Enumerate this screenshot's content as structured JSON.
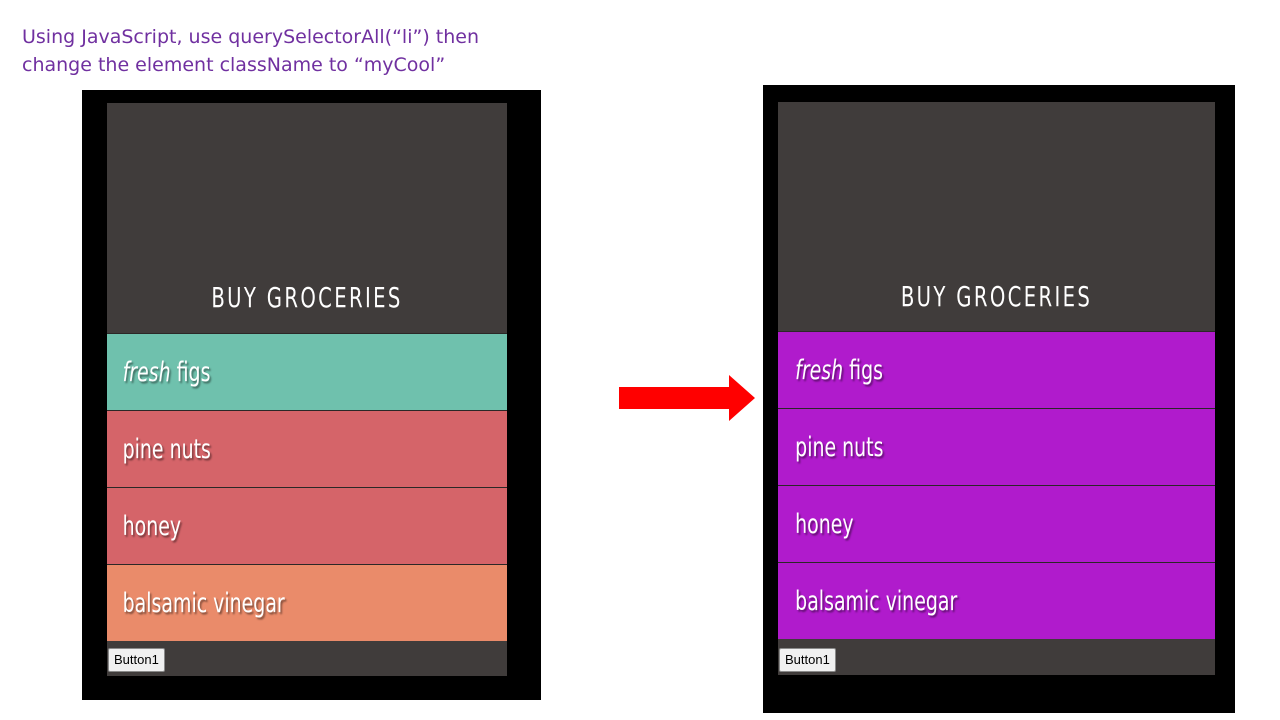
{
  "caption": {
    "line1": "Using JavaScript, use querySelectorAll(“li”) then",
    "line2": "change the element className to “myCool”"
  },
  "left_app": {
    "title": "BUY GROCERIES",
    "items": [
      {
        "emphasis": "fresh",
        "label": " figs",
        "color": "#6fc1ad"
      },
      {
        "emphasis": "",
        "label": "pine nuts",
        "color": "#d56469"
      },
      {
        "emphasis": "",
        "label": "honey",
        "color": "#d56469"
      },
      {
        "emphasis": "",
        "label": "balsamic vinegar",
        "color": "#ea8b6a"
      }
    ],
    "button_label": "Button1"
  },
  "right_app": {
    "title": "BUY GROCERIES",
    "items": [
      {
        "emphasis": "fresh",
        "label": " figs",
        "color": "#b01bcc"
      },
      {
        "emphasis": "",
        "label": "pine nuts",
        "color": "#b01bcc"
      },
      {
        "emphasis": "",
        "label": "honey",
        "color": "#b01bcc"
      },
      {
        "emphasis": "",
        "label": "balsamic vinegar",
        "color": "#b01bcc"
      }
    ],
    "button_label": "Button1"
  },
  "arrow": {
    "icon": "right-arrow-icon",
    "color": "#ff0000"
  }
}
